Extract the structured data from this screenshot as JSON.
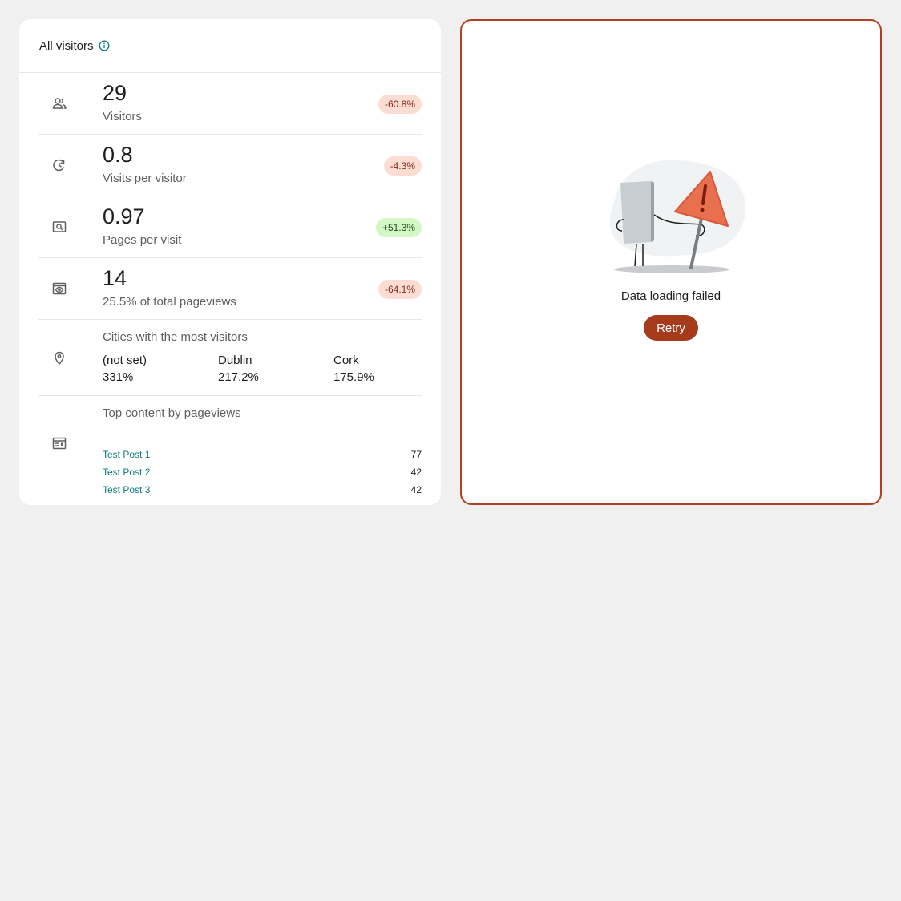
{
  "overview": {
    "title": "All visitors",
    "metrics": [
      {
        "icon": "people-icon",
        "value": "29",
        "label": "Visitors",
        "change": "-60.8%",
        "trend": "down"
      },
      {
        "icon": "repeat-icon",
        "value": "0.8",
        "label": "Visits per visitor",
        "change": "-4.3%",
        "trend": "down"
      },
      {
        "icon": "page-search-icon",
        "value": "0.97",
        "label": "Pages per visit",
        "change": "+51.3%",
        "trend": "up"
      },
      {
        "icon": "eye-icon",
        "value": "14",
        "label": "25.5% of total pageviews",
        "change": "-64.1%",
        "trend": "down"
      }
    ],
    "cities": {
      "title": "Cities with the most visitors",
      "items": [
        {
          "name": "(not set)",
          "value": "331%"
        },
        {
          "name": "Dublin",
          "value": "217.2%"
        },
        {
          "name": "Cork",
          "value": "175.9%"
        }
      ]
    },
    "top_content": {
      "title": "Top content by pageviews",
      "items": [
        {
          "title": "Test Post 1",
          "views": "77"
        },
        {
          "title": "Test Post 2",
          "views": "42"
        },
        {
          "title": "Test Post 3",
          "views": "42"
        }
      ]
    }
  },
  "error_panel": {
    "message": "Data loading failed",
    "retry_label": "Retry"
  },
  "colors": {
    "accent_teal": "#0f7b7e",
    "error_red": "#a53a1c",
    "negative_badge_bg": "#fcdcd3",
    "positive_badge_bg": "#d4f7c6",
    "page_bg": "#f0f0f0"
  }
}
